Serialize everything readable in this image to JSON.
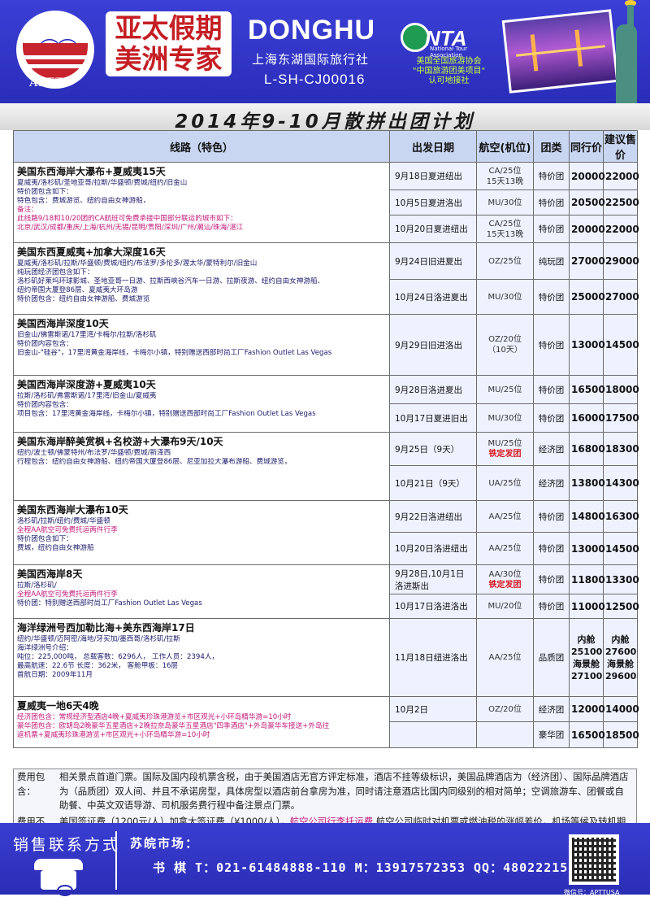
{
  "header": {
    "logo_text": "APTT",
    "brand_line1": "亚太假期",
    "brand_line2": "美洲专家",
    "donghu": "DONGHU",
    "agency_name": "上海东湖国际旅行社",
    "license": "L-SH-CJ00016",
    "nta_logo": "NTA",
    "nta_sub": "National Tour Association",
    "nta_desc": "美国全国旅游协会\n\"中国旅游团美项目\"\n认可地接社",
    "colors": {
      "brand_bg": "#2c2fc0",
      "brand_red": "#c41e24",
      "accent_green": "#c8ff3c"
    }
  },
  "title": "2014年9-10月散拼出团计划",
  "table": {
    "headers": [
      "线路（特色）",
      "出发日期",
      "航空(机位)",
      "团类",
      "同行价",
      "建议售价"
    ],
    "routes": [
      {
        "title": "美国东西海岸大瀑布+夏威夷15天",
        "lines": [
          {
            "text": "夏威夷/洛杉矶/圣地亚哥/拉斯/华盛顿/费城/纽约/旧金山",
            "red": false
          },
          {
            "text": "特价团包含如下：",
            "red": false
          },
          {
            "text": "特色包含：费城游览、纽约自由女神游船，",
            "red": false
          },
          {
            "text": "备注：",
            "red": true
          },
          {
            "text": "此线路9/18和10/20团的CA航班可免费承接中国部分联运的城市如下：",
            "red": true
          },
          {
            "text": "北京/武汉/成都/重庆/上海/杭州/无锡/昆明/贵阳/深圳/广州/潮汕/珠海/湛江",
            "red": true
          }
        ],
        "departures": [
          {
            "date": "9月18日夏进纽出",
            "air": "CA/25位\n15天13晚",
            "air_note": "",
            "type": "特价团",
            "peer": "20000",
            "price": "22000"
          },
          {
            "date": "10月5日夏进洛出",
            "air": "MU/30位",
            "air_note": "",
            "type": "特价团",
            "peer": "20500",
            "price": "22500"
          },
          {
            "date": "10月20日夏进纽出",
            "air": "CA/25位\n15天13晚",
            "air_note": "",
            "type": "特价团",
            "peer": "20000",
            "price": "22000"
          }
        ]
      },
      {
        "title": "美国东西夏威夷+加拿大深度16天",
        "lines": [
          {
            "text": "夏威夷/洛杉矶/拉斯/华盛顿/费城/纽约/布法罗/多伦多/渥太华/蒙特利尔/旧金山",
            "red": false
          },
          {
            "text": "纯玩团经济团包含如下：",
            "red": false
          },
          {
            "text": "洛杉矶好莱坞环球影城、圣地亚哥一日游、拉斯西峡谷汽车一日游、拉斯夜游、纽约自由女神游船、",
            "red": false
          },
          {
            "text": "纽约帝国大厦登86层、夏威夷大环岛游",
            "red": false
          },
          {
            "text": "特价团包含：纽约自由女神游船、费城游览",
            "red": false
          }
        ],
        "departures": [
          {
            "date": "9月24日旧进夏出",
            "air": "OZ/25位",
            "air_note": "",
            "type": "纯玩团",
            "peer": "27000",
            "price": "29000"
          },
          {
            "date": "10月24日洛进夏出",
            "air": "MU/30位",
            "air_note": "",
            "type": "特价团",
            "peer": "25000",
            "price": "27000"
          }
        ]
      },
      {
        "title": "美国西海岸深度10天",
        "lines": [
          {
            "text": "旧金山/佛雷斯诺/17里湾/卡梅尔/拉斯/洛杉矶",
            "red": false
          },
          {
            "text": "特价团内容包含：",
            "red": false
          },
          {
            "text": "旧金山-\"硅谷\"，17里湾黄金海岸线，卡梅尔小镇，特别赠送西部时尚工厂Fashion Outlet Las Vegas",
            "red": false
          }
        ],
        "departures": [
          {
            "date": "9月29日旧进洛出",
            "air": "OZ/20位\n（10天）",
            "air_note": "",
            "type": "特价团",
            "peer": "13000",
            "price": "14500"
          }
        ]
      },
      {
        "title": "美国西海岸深度游+夏威夷10天",
        "lines": [
          {
            "text": "拉斯/洛杉矶/弗雷斯诺/17里湾/旧金山/夏威夷",
            "red": false
          },
          {
            "text": "特价团内容包含：",
            "red": false
          },
          {
            "text": "项目包含：17里湾黄金海岸线，卡梅尔小镇，特别赠送西部时尚工厂Fashion Outlet Las Vegas",
            "red": false
          }
        ],
        "departures": [
          {
            "date": "9月28日洛进夏出",
            "air": "MU/25位",
            "air_note": "",
            "type": "特价团",
            "peer": "16500",
            "price": "18000"
          },
          {
            "date": "10月17日夏进旧出",
            "air": "MU/30位",
            "air_note": "",
            "type": "特价团",
            "peer": "16000",
            "price": "17500"
          }
        ]
      },
      {
        "title": "美国东海岸醉美赏枫+名校游+大瀑布9天/10天",
        "lines": [
          {
            "text": "纽约/波士顿/佛蒙特州/布法罗/华盛顿/费城/新泽西",
            "red": false
          },
          {
            "text": "行程包含：纽约自由女神游船、纽约帝国大厦登86层、尼亚加拉大瀑布游船、费城游览，",
            "red": false
          }
        ],
        "departures": [
          {
            "date": "9月25日（9天）",
            "air": "MU/25位",
            "air_note": "铁定发团",
            "type": "经济团",
            "peer": "16800",
            "price": "18300"
          },
          {
            "date": "10月21日（9天）",
            "air": "UA/25位",
            "air_note": "",
            "type": "经济团",
            "peer": "13800",
            "price": "14300"
          }
        ]
      },
      {
        "title": "美国东西海岸大瀑布10天",
        "lines": [
          {
            "text": "洛杉矶/拉斯/纽约/费城/华盛顿",
            "red": false
          },
          {
            "text": "全程AA航空可免费托运两件行李",
            "red": true
          },
          {
            "text": "特价团包含如下：",
            "red": false
          },
          {
            "text": "费城，纽约自由女神游船",
            "red": false
          }
        ],
        "departures": [
          {
            "date": "9月22日洛进纽出",
            "air": "AA/25位",
            "air_note": "",
            "type": "特价团",
            "peer": "14800",
            "price": "16300"
          },
          {
            "date": "10月20日洛进纽出",
            "air": "AA/25位",
            "air_note": "",
            "type": "特价团",
            "peer": "13000",
            "price": "14500"
          }
        ]
      },
      {
        "title": "美国西海岸8天",
        "lines": [
          {
            "text": "拉斯/洛杉矶/",
            "red": false
          },
          {
            "text": "全程AA航空可免费托运两件行李",
            "red": true
          },
          {
            "text": "特价团：特别赠送西部时尚工厂Fashion Outlet Las Vegas",
            "red": false
          }
        ],
        "departures": [
          {
            "date": "9月28日,10月1日\n洛进斯出",
            "air": "AA/30位",
            "air_note": "铁定发团",
            "type": "特价团",
            "peer": "11800",
            "price": "13300"
          },
          {
            "date": "10月17日洛进洛出",
            "air": "MU/20位",
            "air_note": "",
            "type": "特价团",
            "peer": "11000",
            "price": "12500"
          }
        ]
      },
      {
        "title": "海洋绿洲号西加勒比海+美东西海岸17日",
        "lines": [
          {
            "text": "纽约/华盛顿/迈阿密/海地/牙买加/墨西哥/洛杉矶/拉斯",
            "red": false
          },
          {
            "text": "海洋绿洲号介绍：",
            "red": false
          },
          {
            "text": "吨位：225,000吨，   总载客数：6296人，   工作人员：2394人，",
            "red": false
          },
          {
            "text": "最高航速：22.6节   长度：362米，       客舱甲板：16层",
            "red": false
          },
          {
            "text": "首航日期：2009年11月",
            "red": false
          }
        ],
        "departures": [
          {
            "date": "11月18日纽进洛出",
            "air": "AA/25位",
            "air_note": "",
            "type": "品质团",
            "peer": "内舱\n25100\n海景舱\n27100",
            "price": "内舱\n27600\n海景舱\n29600"
          }
        ]
      },
      {
        "title": "夏威夷一地6天4晚",
        "lines": [
          {
            "text": "经济团包含：常规经济型酒店4晚+夏威夷珍珠港游览+市区观光+小环岛精华游=10小时",
            "red": true
          },
          {
            "text": "豪华团包含：欧胡岛2晚豪华五星酒店+2晚拉奈岛豪华五星酒店\"四季酒店\"+外岛豪华车接送+外岛往",
            "red": true
          },
          {
            "text": "返机票+夏威夷珍珠港游览+市区观光+小环岛精华游=10小时",
            "red": true
          }
        ],
        "departures": [
          {
            "date": "10月2日",
            "air": "OZ/20位",
            "air_note": "",
            "type": "经济团",
            "peer": "12000",
            "price": "14000"
          },
          {
            "date": "",
            "air": "",
            "air_note": "",
            "type": "豪华团",
            "peer": "16500",
            "price": "18500"
          }
        ]
      }
    ]
  },
  "fees": {
    "included_label": "费用包含：",
    "included_text": "相关景点首道门票。国际及国内段机票含税，由于美国酒店无官方评定标准，酒店不挂等级标识，美国品牌酒店为（经济团）、国际品牌酒店为（品质团）双人间、并且不承诺房型，具体房型以酒店前台拿房为准，同时请注意酒店比国内同级别的相对简单；空调旅游车、团餐或自助餐、中英文双语导游、司机服务费行程中备注景点门票。",
    "excluded_label": "费用不含：",
    "excluded_text_a": "美国签证费（1200元/人）加拿大签证费（¥1000/人），",
    "excluded_text_pink": "航空公司行李托运费",
    "excluded_text_b": ",航空公司临时对机票或燃油税的涨幅差价，机场等候及转机期间用餐、个人购物、自选项目费用、电话等私人费用。"
  },
  "contact": {
    "title": "销售联系方式",
    "market": "苏皖市场：",
    "line": "书  棋  T：021-61484888-110  M：13917572353  QQ：480222155",
    "qr_caption": "微信号：APTTUSA",
    "icon": "phone-icon"
  }
}
